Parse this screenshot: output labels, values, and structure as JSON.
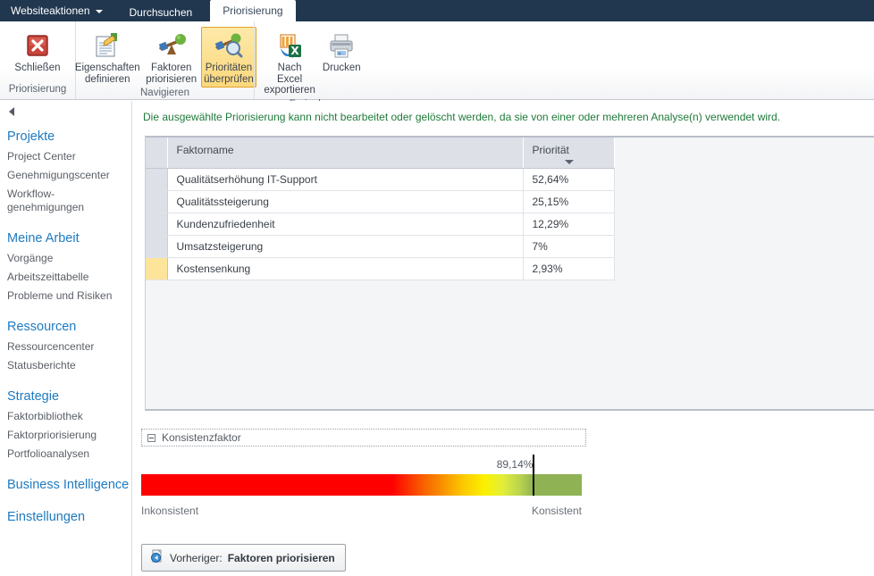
{
  "ribbon": {
    "site_actions": "Websiteaktionen",
    "tabs": [
      {
        "label": "Durchsuchen",
        "active": false
      },
      {
        "label": "Priorisierung",
        "active": true
      }
    ],
    "groups": [
      {
        "label": "Priorisierung",
        "items": [
          {
            "label": "Schließen",
            "icon": "close-red-icon",
            "selected": false
          }
        ]
      },
      {
        "label": "Navigieren",
        "items": [
          {
            "label": "Eigenschaften\ndefinieren",
            "icon": "properties-icon",
            "selected": false
          },
          {
            "label": "Faktoren\npriorisieren",
            "icon": "balance-scale-icon",
            "selected": false
          },
          {
            "label": "Prioritäten\nüberprüfen",
            "icon": "review-priorities-icon",
            "selected": true
          }
        ]
      },
      {
        "label": "Freigeben",
        "items": [
          {
            "label": "Nach Excel\nexportieren",
            "icon": "excel-export-icon",
            "selected": false
          },
          {
            "label": "Drucken",
            "icon": "printer-icon",
            "selected": false
          }
        ]
      }
    ]
  },
  "sidebar": {
    "collapse_icon": "collapse-left-icon",
    "sections": [
      {
        "heading": "Projekte",
        "links": [
          "Project Center",
          "Genehmigungscenter",
          "Workflow-genehmigungen"
        ]
      },
      {
        "heading": "Meine Arbeit",
        "links": [
          "Vorgänge",
          "Arbeitszeittabelle",
          "Probleme und Risiken"
        ]
      },
      {
        "heading": "Ressourcen",
        "links": [
          "Ressourcencenter",
          "Statusberichte"
        ]
      },
      {
        "heading": "Strategie",
        "links": [
          "Faktorbibliothek",
          "Faktorpriorisierung",
          "Portfolioanalysen"
        ]
      },
      {
        "heading": "Business Intelligence",
        "links": []
      },
      {
        "heading": "Einstellungen",
        "links": []
      }
    ]
  },
  "main": {
    "notice": "Die ausgewählte Priorisierung kann nicht bearbeitet oder gelöscht werden, da sie von einer oder mehreren Analyse(n) verwendet wird.",
    "notice_color": "#1f7a3a",
    "table": {
      "columns": [
        "Faktorname",
        "Priorität"
      ],
      "sorted_column": "Priorität",
      "sort_direction": "descending",
      "rows": [
        {
          "name": "Qualitätserhöhung IT-Support",
          "priority": "52,64%",
          "highlighted": false
        },
        {
          "name": "Qualitätssteigerung",
          "priority": "25,15%",
          "highlighted": false
        },
        {
          "name": "Kundenzufriedenheit",
          "priority": "12,29%",
          "highlighted": false
        },
        {
          "name": "Umsatzsteigerung",
          "priority": "7%",
          "highlighted": false
        },
        {
          "name": "Kostensenkung",
          "priority": "2,93%",
          "highlighted": true
        }
      ]
    },
    "consistency": {
      "section_title": "Konsistenzfaktor",
      "value_label": "89,14%",
      "value_percent": 89.14,
      "left_label": "Inkonsistent",
      "right_label": "Konsistent",
      "gradient_start_color": "#fe0000",
      "gradient_end_color": "#8fb254",
      "marker_color": "#000000"
    },
    "previous_button": {
      "prefix": "Vorheriger: ",
      "target": "Faktoren priorisieren",
      "icon": "previous-page-icon"
    }
  }
}
